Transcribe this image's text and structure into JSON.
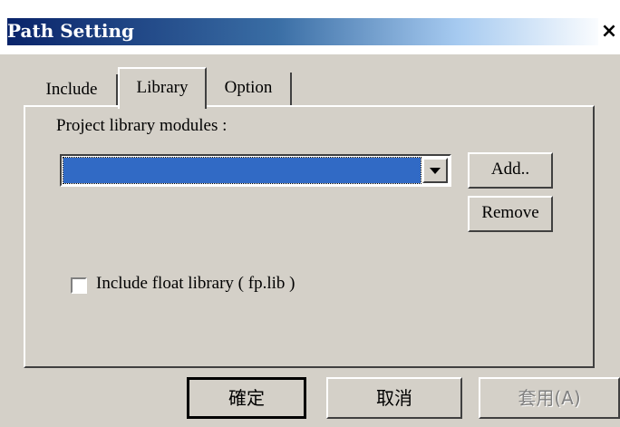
{
  "window": {
    "title": "Path Setting",
    "close_glyph": "×"
  },
  "tabs": [
    {
      "label": "Include",
      "active": false
    },
    {
      "label": "Library",
      "active": true
    },
    {
      "label": "Option",
      "active": false
    }
  ],
  "library": {
    "modules_label": "Project library modules :",
    "add_button": "Add..",
    "remove_button": "Remove",
    "float_checkbox_label": "Include float library ( fp.lib )",
    "float_checked": false
  },
  "footer": {
    "ok_label": "確定",
    "cancel_label": "取消",
    "apply_label": "套用(A)"
  },
  "colors": {
    "window_bg": "#d4d0c8",
    "selection": "#316ac5",
    "title_gradient_start": "#0a246a"
  },
  "icons": {
    "dropdown": "chevron-down-icon",
    "close": "close-icon"
  }
}
